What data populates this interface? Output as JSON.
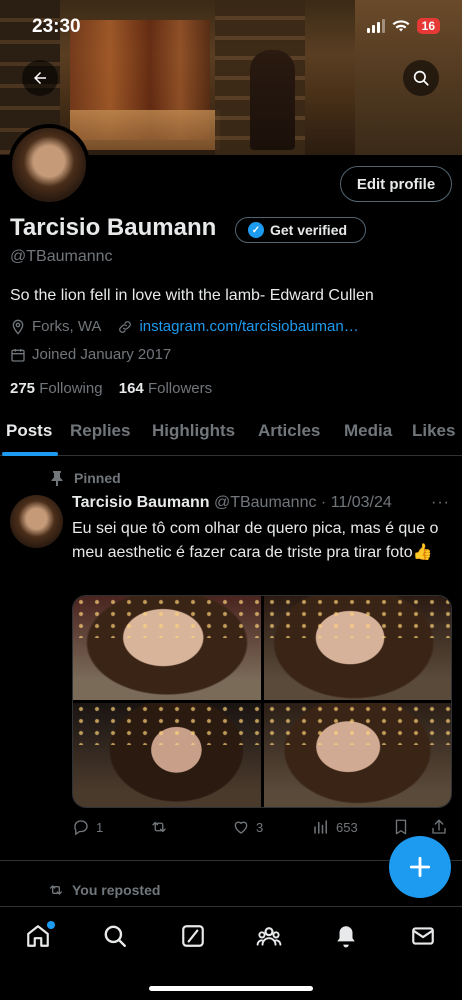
{
  "status": {
    "time": "23:30",
    "battery": "16"
  },
  "profile": {
    "name": "Tarcisio Baumann",
    "get_verified": "Get verified",
    "handle": "@TBaumannc",
    "bio": "So the lion fell in love with the lamb- Edward Cullen",
    "location": "Forks, WA",
    "website": "instagram.com/tarcisiobauman…",
    "joined": "Joined January 2017",
    "following_count": "275",
    "following_label": "Following",
    "followers_count": "164",
    "followers_label": "Followers",
    "edit_profile": "Edit profile"
  },
  "tabs": [
    "Posts",
    "Replies",
    "Highlights",
    "Articles",
    "Media",
    "Likes"
  ],
  "pinned_label": "Pinned",
  "tweet": {
    "author": "Tarcisio Baumann",
    "handle_date": "@TBaumannc · 11/03/24",
    "more": "···",
    "text": "Eu sei que tô com olhar de quero pica, mas é que o meu aesthetic é fazer cara de triste pra tirar foto👍",
    "replies": "1",
    "retweets": "",
    "likes": "3",
    "views": "653"
  },
  "reposted_label": "You reposted",
  "colors": {
    "accent": "#1d9bf0",
    "muted": "#71767b",
    "text": "#e7e9ea",
    "border": "#2f3336"
  },
  "icons": {
    "back": "arrow-left-icon",
    "search": "search-icon",
    "location": "location-pin-icon",
    "link": "link-icon",
    "calendar": "calendar-icon",
    "pin": "pin-icon",
    "nav": [
      "home-icon",
      "search-icon",
      "grok-icon",
      "communities-icon",
      "notifications-icon",
      "messages-icon"
    ]
  }
}
